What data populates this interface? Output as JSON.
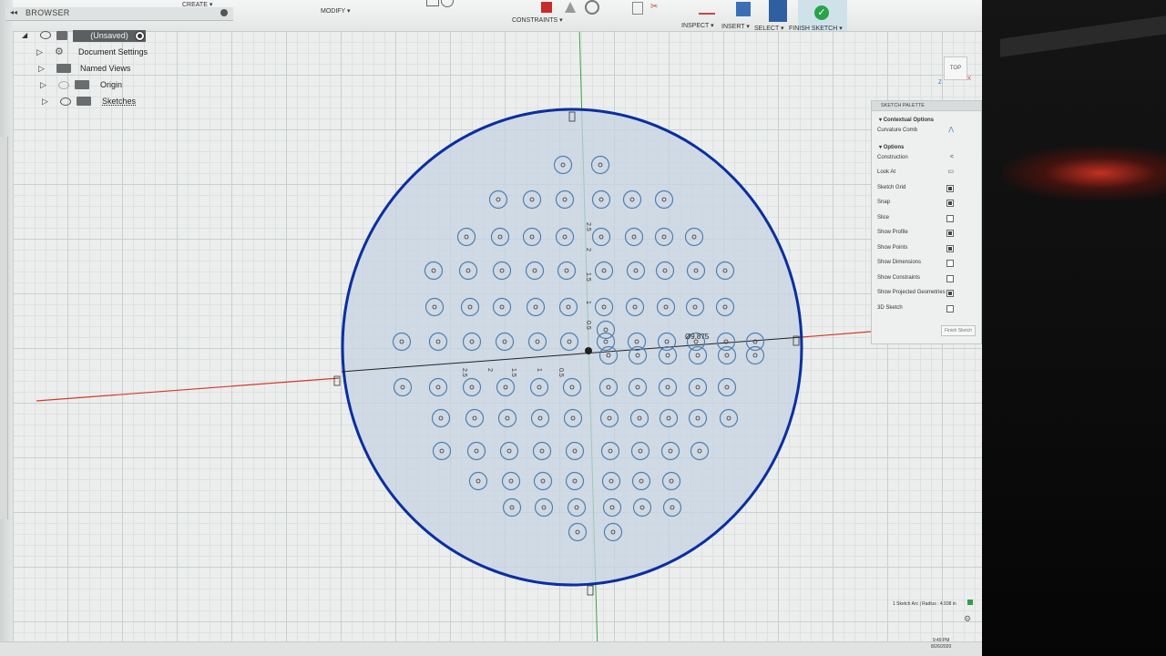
{
  "toolbar": {
    "create_label": "CREATE ▾",
    "modify_label": "MODIFY ▾",
    "constraints_label": "CONSTRAINTS ▾",
    "inspect_label": "INSPECT ▾",
    "insert_label": "INSERT ▾",
    "select_label": "SELECT ▾",
    "finish_sketch_label": "FINISH SKETCH ▾"
  },
  "browser": {
    "title": "BROWSER",
    "collapse_glyph": "◂◂",
    "root_label": "(Unsaved)",
    "items": [
      {
        "label": "Document Settings",
        "icon": "gear-icon"
      },
      {
        "label": "Named Views",
        "icon": "folder-icon"
      },
      {
        "label": "Origin",
        "icon": "folder-icon"
      },
      {
        "label": "Sketches",
        "icon": "folder-icon"
      }
    ]
  },
  "sketch_palette": {
    "title": "SKETCH PALETTE",
    "contextual_title": "Contextual Options",
    "curvature_comb": "Curvature Comb",
    "options_title": "Options",
    "options": [
      {
        "label": "Construction",
        "control": "construction-icon",
        "checked": false
      },
      {
        "label": "Look At",
        "control": "look-at-icon",
        "checked": false
      },
      {
        "label": "Sketch Grid",
        "control": "checkbox",
        "checked": true
      },
      {
        "label": "Snap",
        "control": "checkbox",
        "checked": true
      },
      {
        "label": "Slice",
        "control": "checkbox",
        "checked": false
      },
      {
        "label": "Show Profile",
        "control": "checkbox",
        "checked": true
      },
      {
        "label": "Show Points",
        "control": "checkbox",
        "checked": true
      },
      {
        "label": "Show Dimensions",
        "control": "checkbox",
        "checked": false
      },
      {
        "label": "Show Constraints",
        "control": "checkbox",
        "checked": false
      },
      {
        "label": "Show Projected Geometries",
        "control": "checkbox",
        "checked": true
      },
      {
        "label": "3D Sketch",
        "control": "checkbox",
        "checked": false
      }
    ],
    "finish_button": "Finish Sketch"
  },
  "viewcube": {
    "label": "TOP"
  },
  "sketch": {
    "diameter_label": "Ø9.875",
    "axis_labels_vertical": [
      "2.5",
      "2",
      "1.5",
      "1",
      "0.5"
    ],
    "axis_labels_horizontal": [
      "2.5",
      "2",
      "1.5",
      "1",
      "0.5"
    ],
    "circle_color": "#0b2fa0",
    "hole_color": "#4f7fae",
    "profile_fill": "#c5d3e2",
    "axis_red": "#d23a2a",
    "axis_green": "#3aa34a"
  },
  "status": {
    "selection_text": "1 Sketch Arc | Radius : 4.938 in",
    "clock_time": "9:49 PM",
    "clock_date": "8/26/2020"
  }
}
